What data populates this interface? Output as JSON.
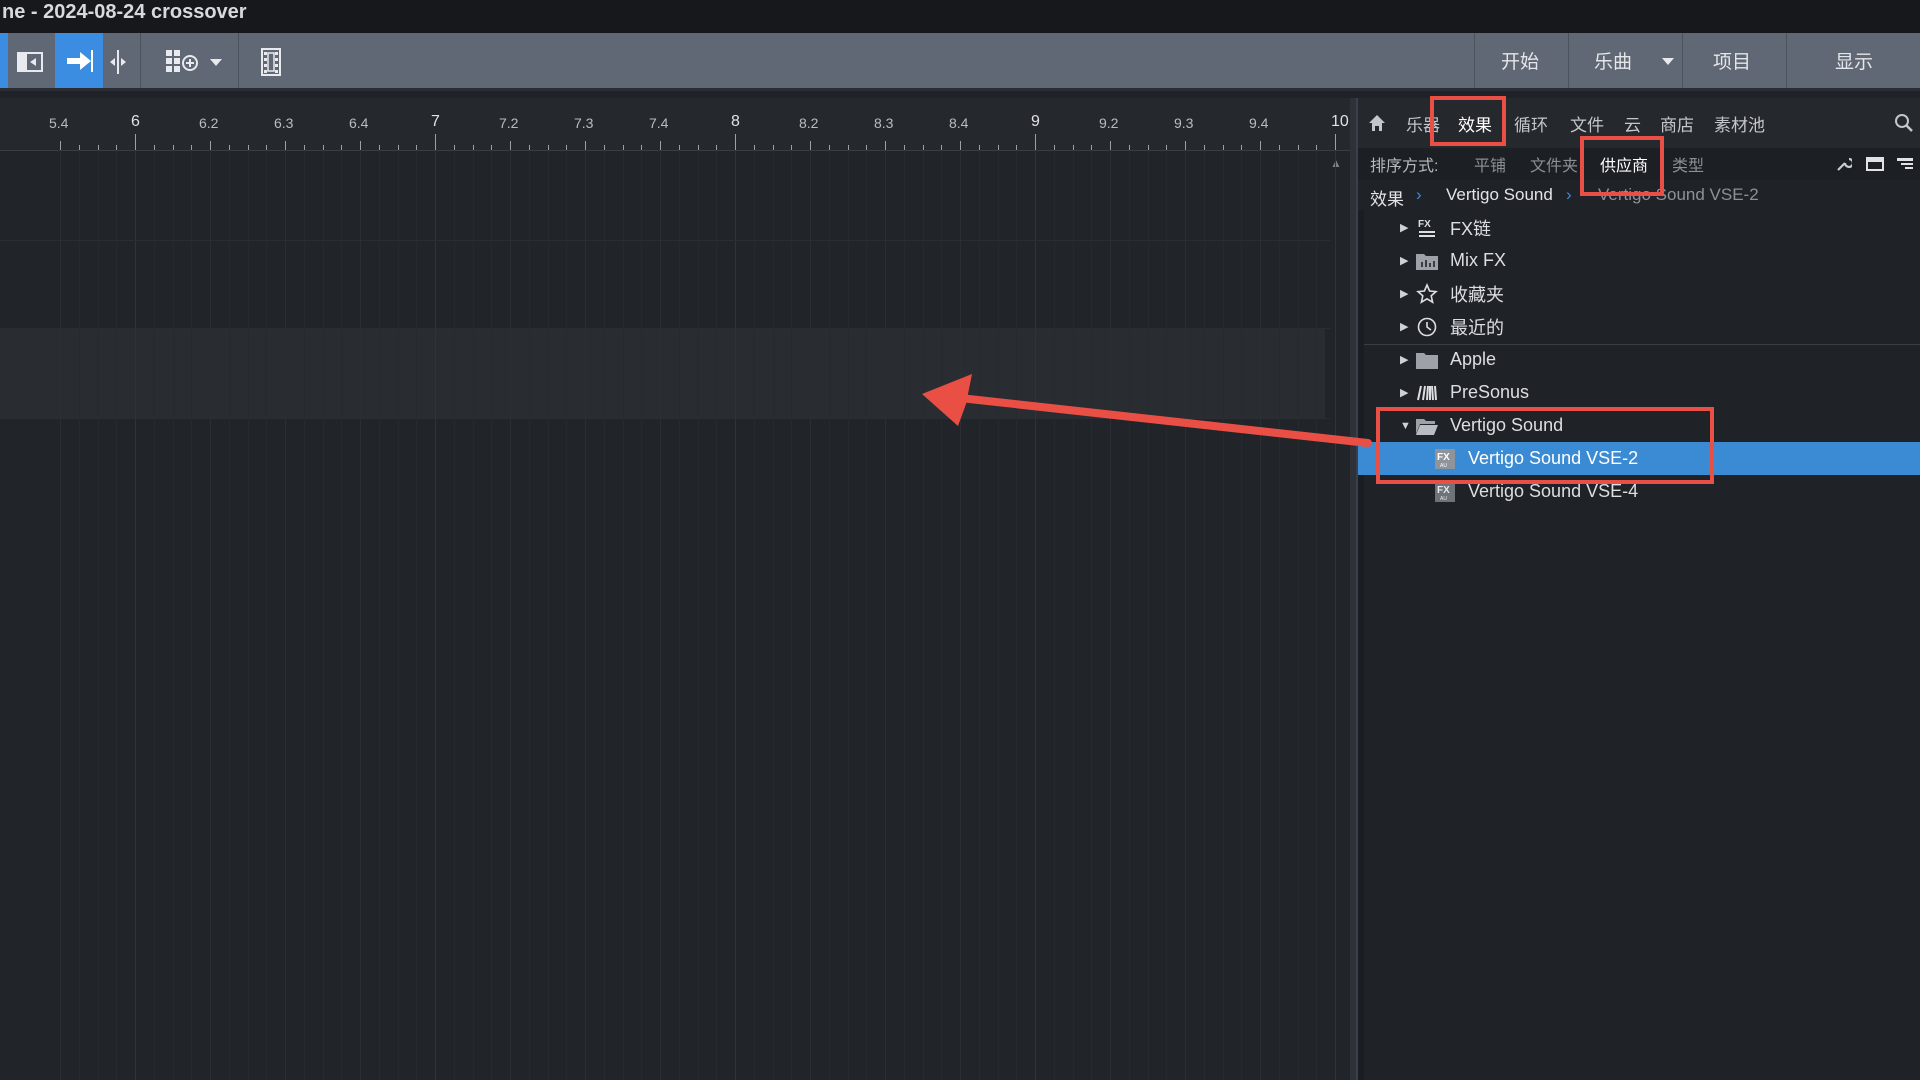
{
  "window": {
    "title": "ne - 2024-08-24 crossover"
  },
  "toolbar": {
    "menus": {
      "start": "开始",
      "song": "乐曲",
      "project": "项目",
      "show": "显示"
    },
    "accent": "#3a8de0"
  },
  "timeline": {
    "ruler": [
      "5.4",
      "6",
      "6.2",
      "6.3",
      "6.4",
      "7",
      "7.2",
      "7.3",
      "7.4",
      "8",
      "8.2",
      "8.3",
      "8.4",
      "9",
      "9.2",
      "9.3",
      "9.4",
      "10"
    ]
  },
  "browser": {
    "tabs": {
      "instruments": "乐器",
      "effects": "效果",
      "loops": "循环",
      "files": "文件",
      "cloud": "云",
      "store": "商店",
      "pool": "素材池"
    },
    "sort": {
      "label": "排序方式:",
      "tile": "平铺",
      "folder": "文件夹",
      "vendor": "供应商",
      "type": "类型"
    },
    "breadcrumb": [
      "效果",
      "Vertigo Sound",
      "Vertigo Sound VSE-2"
    ],
    "tree": {
      "fx_chain": "FX链",
      "mix_fx": "Mix FX",
      "favorites": "收藏夹",
      "recent": "最近的",
      "apple": "Apple",
      "presonus": "PreSonus",
      "vertigo": "Vertigo Sound",
      "vse2": "Vertigo Sound VSE-2",
      "vse4": "Vertigo Sound VSE-4"
    },
    "selected_color": "#3a8ad4"
  },
  "annotation": {
    "color": "#ea4f45"
  }
}
